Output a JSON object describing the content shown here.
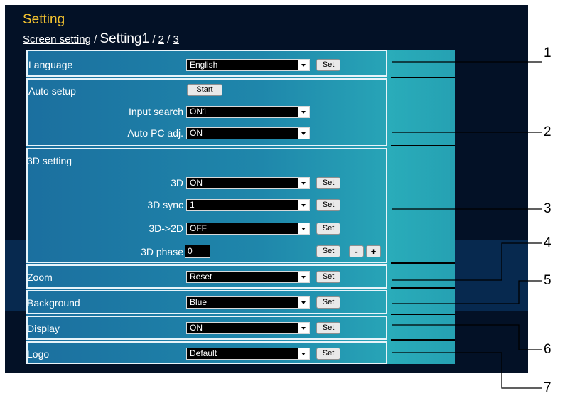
{
  "header": {
    "title": "Setting",
    "breadcrumb": {
      "first": "Screen setting",
      "sep1": "/",
      "current": "Setting1",
      "sep2": "/",
      "second": "2",
      "sep3": "/",
      "third": "3"
    }
  },
  "language": {
    "label": "Language",
    "value": "English",
    "set_label": "Set"
  },
  "auto_setup": {
    "label": "Auto setup",
    "start_label": "Start",
    "input_search": {
      "label": "Input search",
      "value": "ON1"
    },
    "auto_pc_adj": {
      "label": "Auto PC adj.",
      "value": "ON"
    }
  },
  "setting_3d": {
    "label": "3D setting",
    "mode": {
      "label": "3D",
      "value": "ON",
      "set_label": "Set"
    },
    "sync": {
      "label": "3D sync",
      "value": "1",
      "set_label": "Set"
    },
    "conv": {
      "label": "3D->2D",
      "value": "OFF",
      "set_label": "Set"
    },
    "phase": {
      "label": "3D phase",
      "value": "0",
      "set_label": "Set",
      "minus": "-",
      "plus": "+"
    }
  },
  "zoom": {
    "label": "Zoom",
    "value": "Reset",
    "set_label": "Set"
  },
  "background": {
    "label": "Background",
    "value": "Blue",
    "set_label": "Set"
  },
  "display": {
    "label": "Display",
    "value": "ON",
    "set_label": "Set"
  },
  "logo": {
    "label": "Logo",
    "value": "Default",
    "set_label": "Set"
  },
  "callouts": [
    "1",
    "2",
    "3",
    "4",
    "5",
    "6",
    "7"
  ],
  "colors": {
    "title": "#f2c230",
    "panel": "#1c7ca6",
    "panel_light": "#2aa6b8",
    "frame": "#031126",
    "border": "#e8f4fa"
  }
}
